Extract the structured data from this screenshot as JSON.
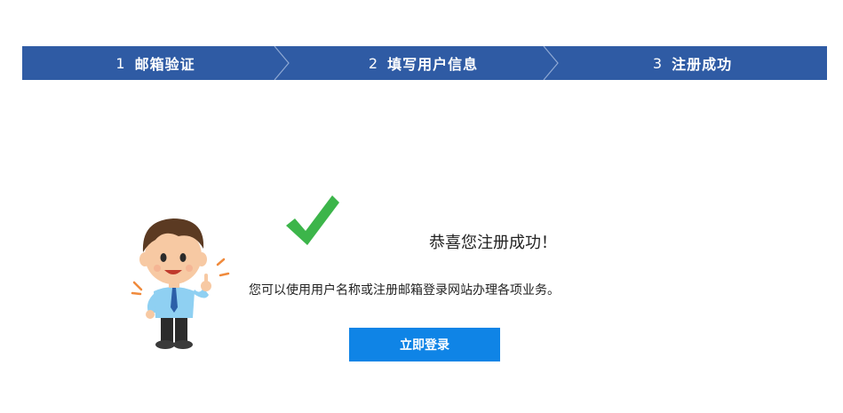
{
  "steps": [
    {
      "number": "1",
      "label": "邮箱验证"
    },
    {
      "number": "2",
      "label": "填写用户信息"
    },
    {
      "number": "3",
      "label": "注册成功"
    }
  ],
  "colors": {
    "step_bar": "#2f5ba4",
    "button": "#0f84e6",
    "check": "#3cb54a"
  },
  "success": {
    "headline": "恭喜您注册成功！",
    "description": "您可以使用用户名称或注册邮箱登录网站办理各项业务。"
  },
  "actions": {
    "login_label": "立即登录"
  },
  "icons": {
    "check": "checkmark-icon",
    "person": "thumbs-up-person-illustration"
  }
}
